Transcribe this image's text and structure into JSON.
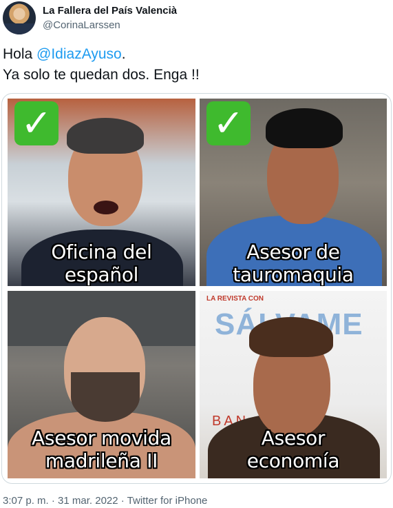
{
  "tweet": {
    "display_name": "La Fallera del País Valencià",
    "username": "@CorinaLarssen",
    "text_line1_prefix": "Hola ",
    "mention": "@IdiazAyuso",
    "text_line1_suffix": ".",
    "text_line2": "Ya solo te quedan dos. Enga !!"
  },
  "media": {
    "images": [
      {
        "caption_lines": [
          "Oficina del",
          "español"
        ],
        "checked": true
      },
      {
        "caption_lines": [
          "Asesor de",
          "tauromaquia"
        ],
        "checked": true
      },
      {
        "caption_lines": [
          "Asesor  movida",
          "madrileña II"
        ],
        "checked": false
      },
      {
        "caption_lines": [
          "Asesor",
          "economía"
        ],
        "checked": false,
        "poster_text": {
          "top": "LA REVISTA CON",
          "logo": "SÁLVAME",
          "side": "BAN"
        }
      }
    ],
    "check_glyph": "✓"
  },
  "meta": {
    "time": "3:07 p. m.",
    "separator": " · ",
    "date": "31 mar. 2022",
    "source": "Twitter for iPhone"
  },
  "colors": {
    "link": "#1d9bf0",
    "secondary_text": "#536471",
    "check_green": "#3fba2e"
  }
}
